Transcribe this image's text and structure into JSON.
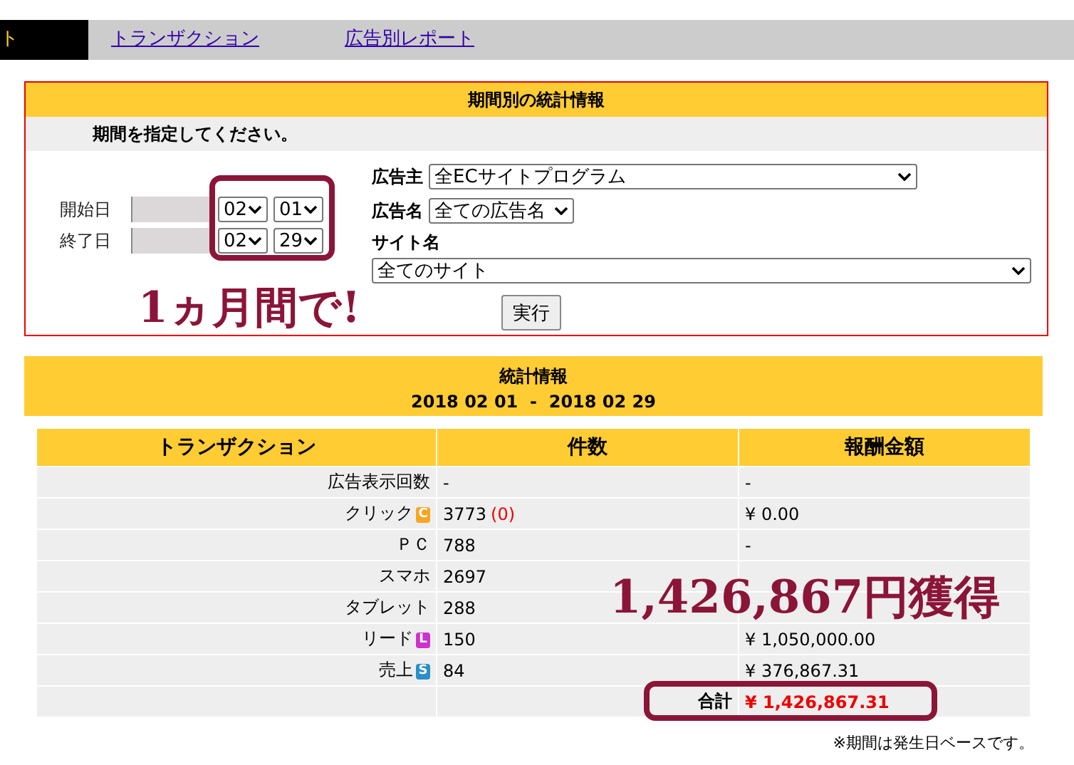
{
  "tabs": [
    {
      "label": "ト",
      "selected": true
    },
    {
      "label": "トランザクション",
      "selected": false
    },
    {
      "label": "広告別レポート",
      "selected": false
    }
  ],
  "period_form": {
    "title": "期間別の統計情報",
    "instruction": "期間を指定してください。",
    "dates": [
      {
        "label": "開始日",
        "month": "02",
        "day": "01"
      },
      {
        "label": "終了日",
        "month": "02",
        "day": "29"
      }
    ],
    "advertiser": {
      "label": "広告主",
      "value": "全ECサイトプログラム"
    },
    "ad_name": {
      "label": "広告名",
      "value": "全ての広告名"
    },
    "site": {
      "label": "サイト名",
      "value": "全てのサイト"
    },
    "submit": "実行"
  },
  "stats": {
    "title": "統計情報",
    "range": "2018 02 01  -  2018 02 29",
    "columns": [
      "トランザクション",
      "件数",
      "報酬金額"
    ],
    "rows": [
      {
        "kind": "data",
        "label": "広告表示回数",
        "count": "-",
        "amount": "-"
      },
      {
        "kind": "data",
        "label": "クリック",
        "badge": {
          "letter": "C",
          "color": "#f5a623"
        },
        "count": "3773",
        "note": "(0)",
        "amount": "¥  0.00"
      },
      {
        "kind": "data",
        "label": "ＰＣ",
        "count": "788",
        "amount": "-"
      },
      {
        "kind": "data",
        "label": "スマホ",
        "count": "2697"
      },
      {
        "kind": "data",
        "label": "タブレット",
        "count": "288"
      },
      {
        "kind": "data",
        "label": "リード",
        "badge": {
          "letter": "L",
          "color": "#cc33cc"
        },
        "count": "150",
        "amount": "¥  1,050,000.00"
      },
      {
        "kind": "data",
        "label": "売上",
        "badge": {
          "letter": "S",
          "color": "#2a8fc7"
        },
        "count": "84",
        "amount": "¥  376,867.31"
      },
      {
        "kind": "total",
        "label": "合計",
        "amount": "¥  1,426,867.31"
      }
    ],
    "footnote": "※期間は発生日ベースです。"
  },
  "annotations": [
    {
      "kind": "callout",
      "text": "1ヵ月間で!"
    },
    {
      "kind": "callout",
      "text": "1,426,867円獲得"
    }
  ]
}
